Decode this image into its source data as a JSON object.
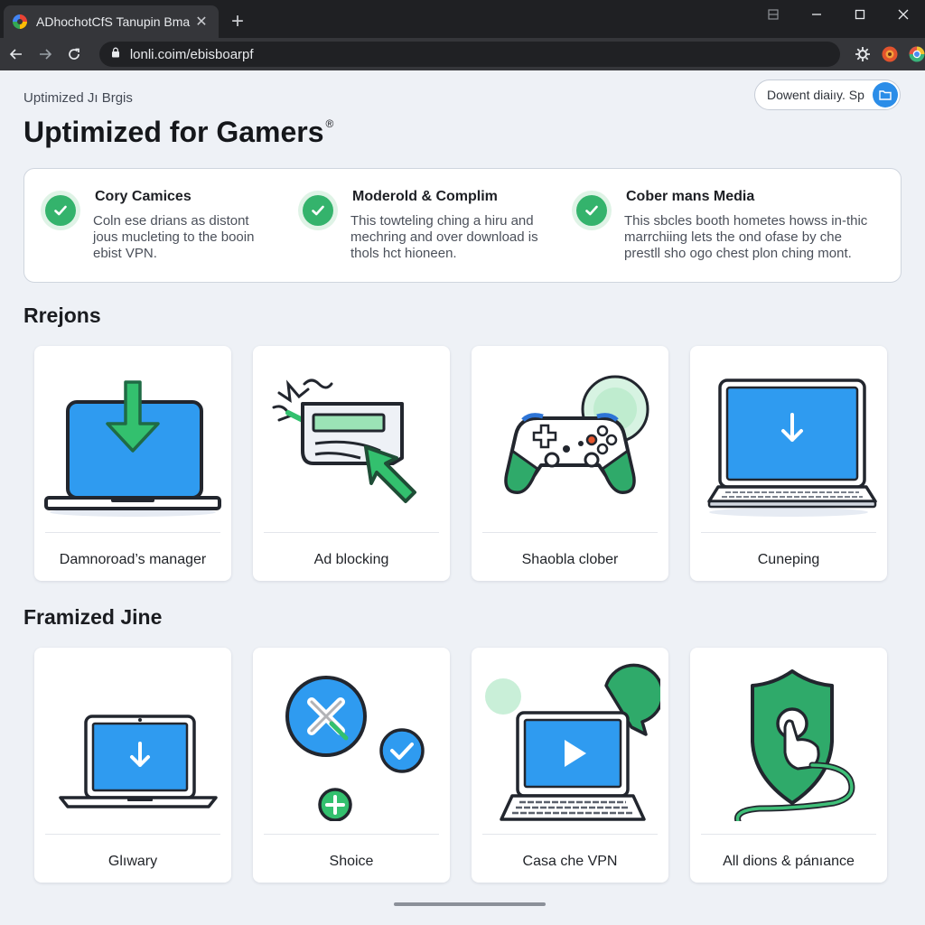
{
  "browser": {
    "tab_title": "ADhochotCfS Tanupin Bma",
    "url": "lonli.coim/ebisboarpf",
    "new_tab_glyph": "+",
    "close_glyph": "✕",
    "icons": [
      "google-favicon",
      "back-arrow-icon",
      "forward-arrow-icon",
      "reload-icon",
      "lock-icon",
      "gear-icon",
      "extension-icon",
      "chrome-profile-icon",
      "minimize-icon",
      "maximize-icon",
      "close-icon"
    ]
  },
  "header": {
    "eyebrow": "Uptimized Jı Brgis",
    "title": "Uptimized for Gamers",
    "title_mark": "®",
    "download_pill_label": "Dowent diaiıy. Sp"
  },
  "features": [
    {
      "title": "Cory Camices",
      "description": [
        "Coln ese drians as distont",
        "jous mucleting to the booin",
        "ebist VPN."
      ]
    },
    {
      "title": "Moderold & Complim",
      "description": [
        "This towteling ching a hiru and",
        "mechring and over download is",
        "thols hct hioneen."
      ]
    },
    {
      "title": "Cober mans Media",
      "description": [
        "This sbcles booth hometes howss in-thic",
        "marrchiing lets the ond ofase by che",
        "prestll sho ogo chest plon ching mont."
      ]
    }
  ],
  "section1": {
    "title": "Rrejons",
    "cards": [
      {
        "label": "Damnoroad’s manager",
        "icon": "laptop-download-icon"
      },
      {
        "label": "Ad blocking",
        "icon": "ad-blocking-cursor-icon"
      },
      {
        "label": "Shaobla clober",
        "icon": "gamepad-icon"
      },
      {
        "label": "Cuneping",
        "icon": "laptop-icon"
      }
    ]
  },
  "section2": {
    "title": "Framized Jine",
    "cards": [
      {
        "label": "Glıwary",
        "icon": "laptop-download-icon"
      },
      {
        "label": "Shoice",
        "icon": "choice-bubbles-icon"
      },
      {
        "label": "Casa che VPN",
        "icon": "laptop-play-icon"
      },
      {
        "label": "All dions & pánıance",
        "icon": "shield-hand-icon"
      }
    ]
  },
  "colors": {
    "accent_blue": "#2b8de8",
    "accent_green": "#34b36c",
    "page_background": "#eef1f6",
    "chrome_dark": "#202124"
  }
}
